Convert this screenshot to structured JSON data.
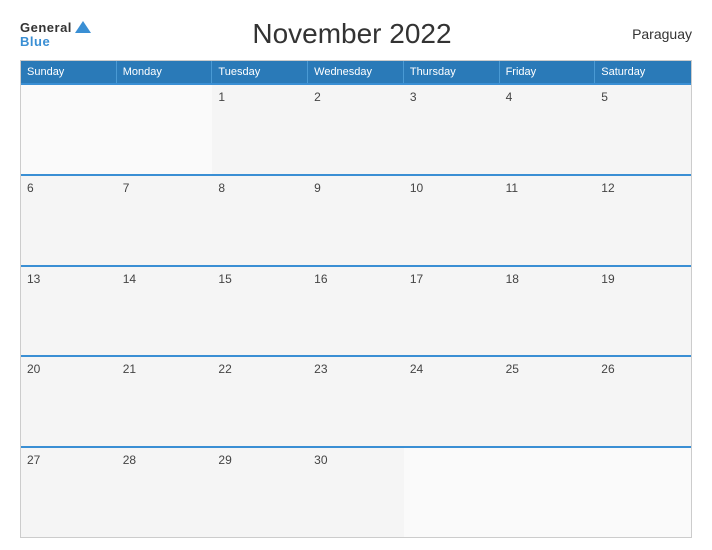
{
  "header": {
    "logo_general": "General",
    "logo_blue": "Blue",
    "title": "November 2022",
    "country": "Paraguay"
  },
  "days_of_week": [
    "Sunday",
    "Monday",
    "Tuesday",
    "Wednesday",
    "Thursday",
    "Friday",
    "Saturday"
  ],
  "weeks": [
    [
      {
        "day": "",
        "empty": true
      },
      {
        "day": "",
        "empty": true
      },
      {
        "day": "1",
        "empty": false
      },
      {
        "day": "2",
        "empty": false
      },
      {
        "day": "3",
        "empty": false
      },
      {
        "day": "4",
        "empty": false
      },
      {
        "day": "5",
        "empty": false
      }
    ],
    [
      {
        "day": "6",
        "empty": false
      },
      {
        "day": "7",
        "empty": false
      },
      {
        "day": "8",
        "empty": false
      },
      {
        "day": "9",
        "empty": false
      },
      {
        "day": "10",
        "empty": false
      },
      {
        "day": "11",
        "empty": false
      },
      {
        "day": "12",
        "empty": false
      }
    ],
    [
      {
        "day": "13",
        "empty": false
      },
      {
        "day": "14",
        "empty": false
      },
      {
        "day": "15",
        "empty": false
      },
      {
        "day": "16",
        "empty": false
      },
      {
        "day": "17",
        "empty": false
      },
      {
        "day": "18",
        "empty": false
      },
      {
        "day": "19",
        "empty": false
      }
    ],
    [
      {
        "day": "20",
        "empty": false
      },
      {
        "day": "21",
        "empty": false
      },
      {
        "day": "22",
        "empty": false
      },
      {
        "day": "23",
        "empty": false
      },
      {
        "day": "24",
        "empty": false
      },
      {
        "day": "25",
        "empty": false
      },
      {
        "day": "26",
        "empty": false
      }
    ],
    [
      {
        "day": "27",
        "empty": false
      },
      {
        "day": "28",
        "empty": false
      },
      {
        "day": "29",
        "empty": false
      },
      {
        "day": "30",
        "empty": false
      },
      {
        "day": "",
        "empty": true
      },
      {
        "day": "",
        "empty": true
      },
      {
        "day": "",
        "empty": true
      }
    ]
  ]
}
